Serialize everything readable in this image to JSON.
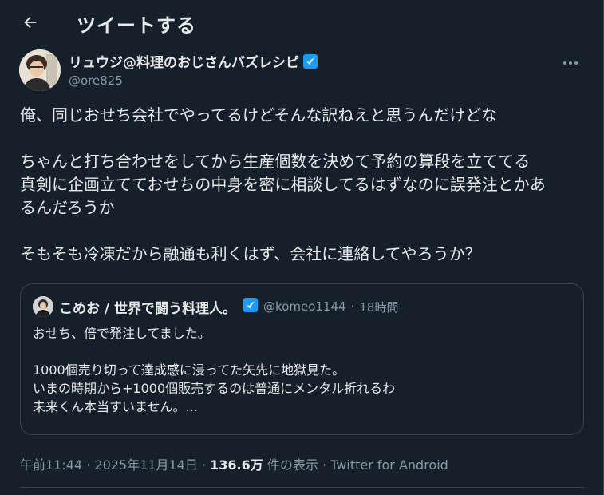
{
  "header": {
    "title": "ツイートする"
  },
  "tweet": {
    "author_name": "リュウジ@料理のおじさんバズレシピ",
    "handle": "@ore825",
    "lines": [
      "俺、同じおせち会社でやってるけどそんな訳ねえと思うんだけどな",
      "",
      "ちゃんと打ち合わせをしてから生産個数を決めて予約の算段を立ててる",
      "真剣に企画立てておせちの中身を密に相談してるはずなのに誤発注とかあ",
      "るんだろうか",
      "",
      "そもそも冷凍だから融通も利くはず、会社に連絡してやろうか？"
    ]
  },
  "quote": {
    "author_name": "こめお / 世界で闘う料理人。",
    "handle": "@komeo1144",
    "separator": "·",
    "time": "18時間",
    "lines": [
      "おせち、倍で発注してました。",
      "",
      "1000個売り切って達成感に浸ってた矢先に地獄見た。",
      "いまの時期から+1000個販売するのは普通にメンタル折れるわ",
      "未来くん本当すいません。..."
    ]
  },
  "meta": {
    "time": "午前11:44",
    "sep1": "·",
    "date": "2025年11月14日",
    "sep2": "·",
    "views_count": "136.6万",
    "views_label": "件の表示",
    "sep3": "·",
    "client": "Twitter for Android"
  },
  "colors": {
    "background": "#15202b",
    "text": "#e7e9ea",
    "muted": "#8b98a5",
    "border": "#38444d",
    "verified": "#1d9bf0"
  },
  "icons": {
    "back": "arrow-left-icon",
    "verified": "verified-badge-icon",
    "more": "more-dots-icon"
  }
}
